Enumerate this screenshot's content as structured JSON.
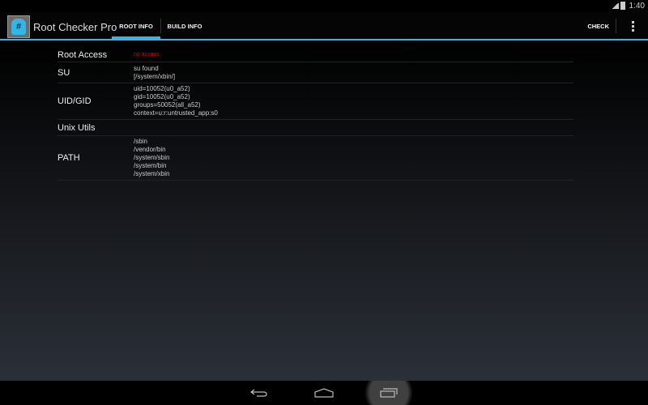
{
  "status": {
    "time": "1:40"
  },
  "app": {
    "title": "Root Checker Pro",
    "tabs": [
      "ROOT INFO",
      "BUILD INFO"
    ],
    "check": "CHECK"
  },
  "rows": [
    {
      "label": "Root Access",
      "lines": [
        "no access"
      ],
      "accent": "#e00000"
    },
    {
      "label": "SU",
      "lines": [
        "su found",
        "[/system/xbin/]"
      ]
    },
    {
      "label": "UID/GID",
      "lines": [
        "uid=10052(u0_a52)",
        "gid=10052(u0_a52)",
        "groups=50052(all_a52)",
        "context=u:r:untrusted_app:s0"
      ]
    },
    {
      "label": "Unix Utils",
      "lines": []
    },
    {
      "label": "PATH",
      "lines": [
        "/sbin",
        "/vendor/bin",
        "/system/sbin",
        "/system/bin",
        "/system/xbin"
      ]
    }
  ],
  "colors": {
    "accent": "#33b5e5"
  }
}
